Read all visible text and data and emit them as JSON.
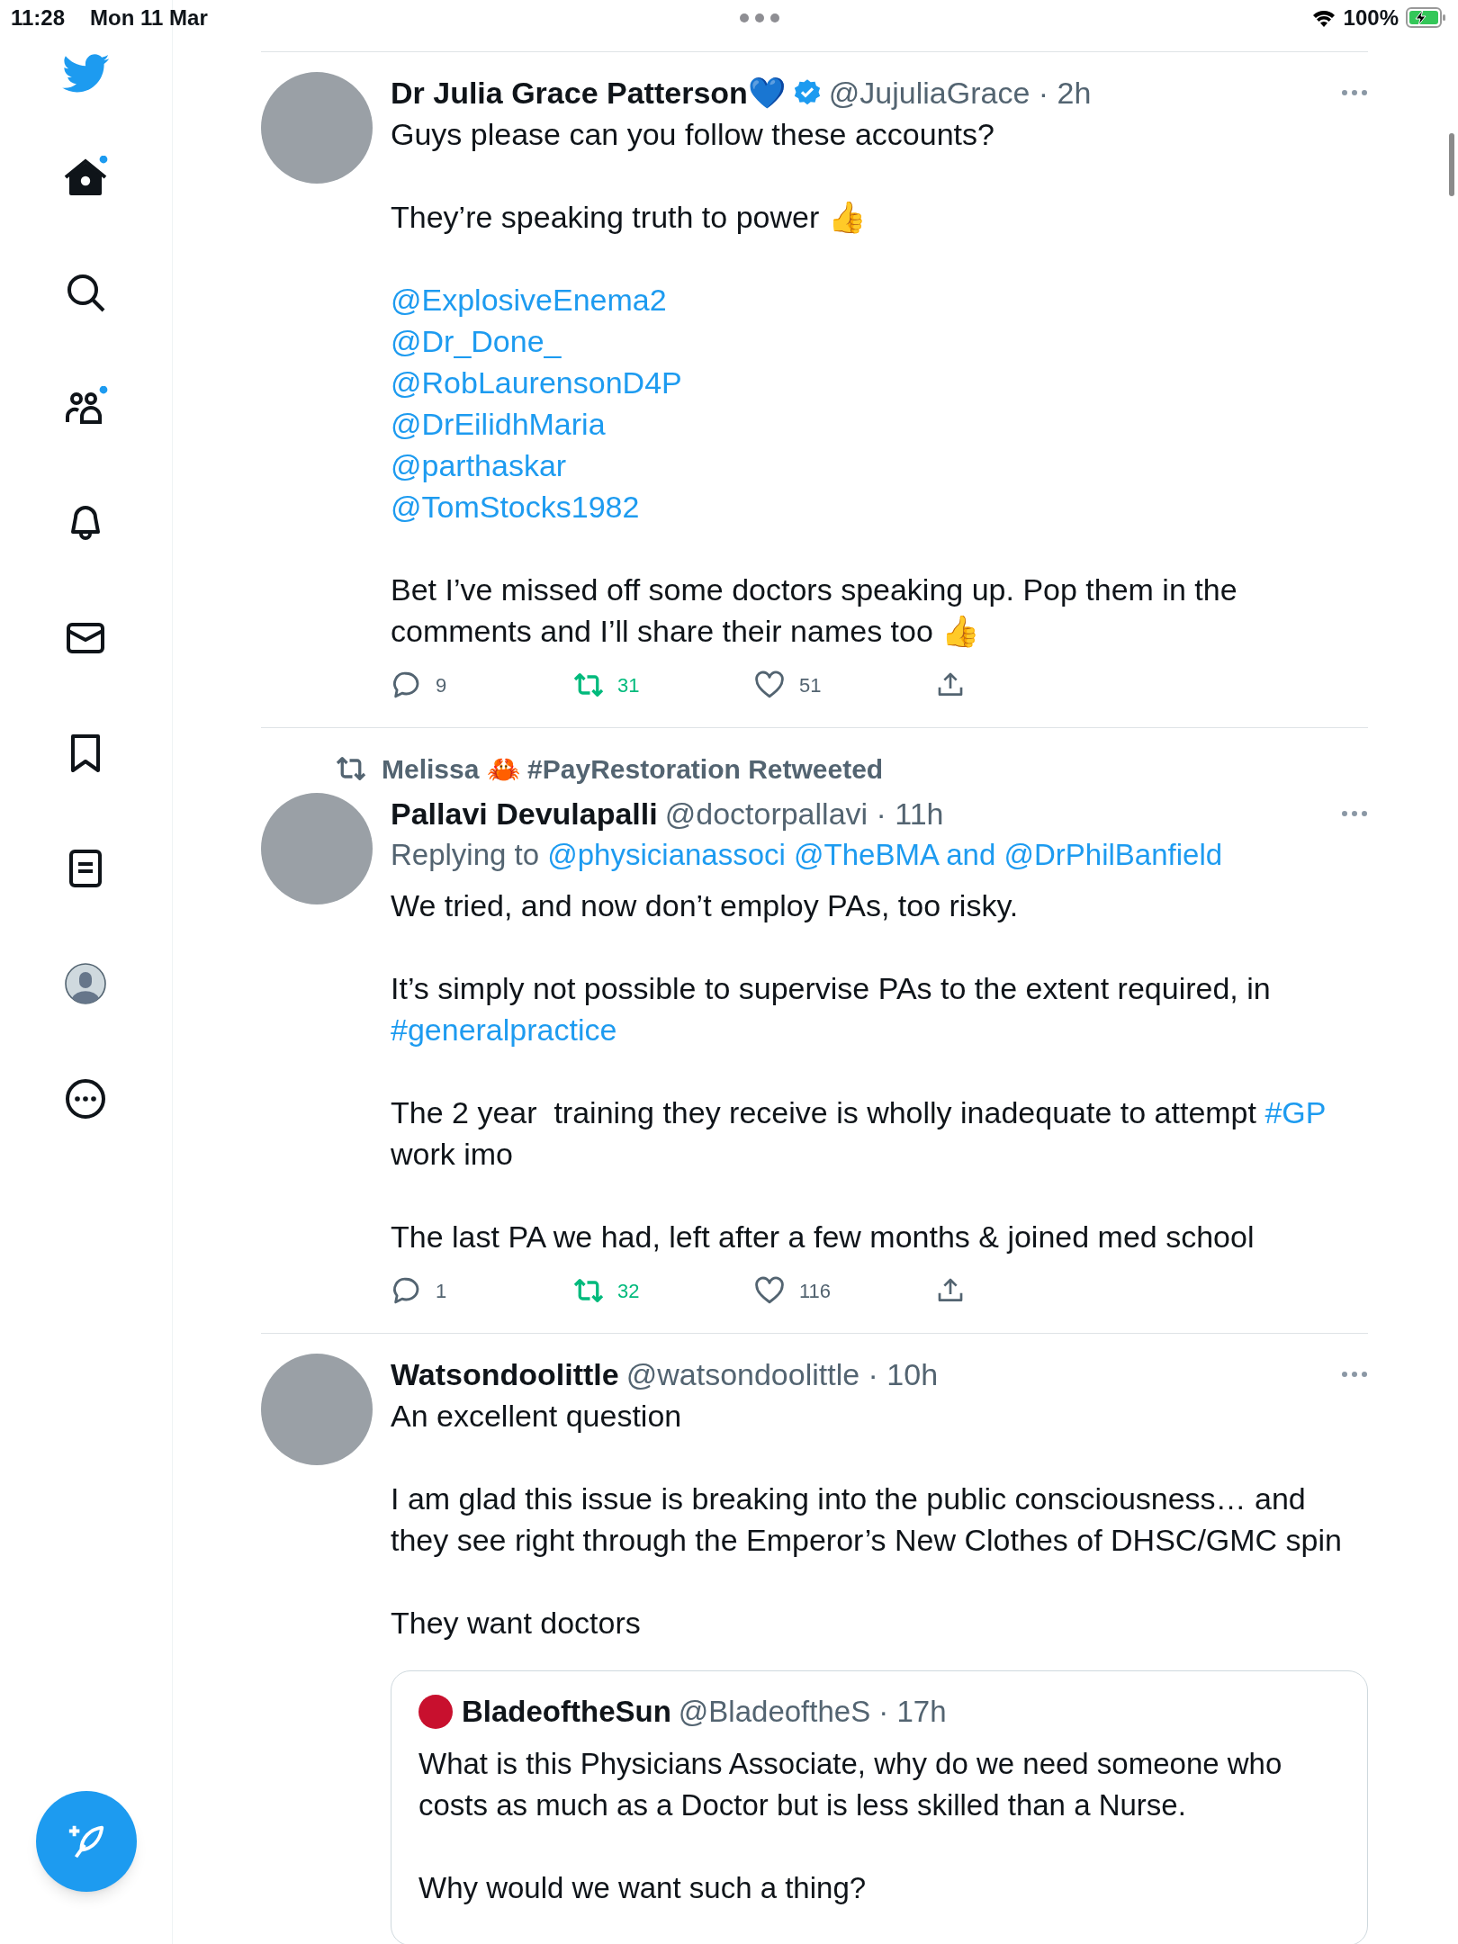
{
  "status_bar": {
    "time": "11:28",
    "date": "Mon 11 Mar",
    "battery": "100%",
    "charging": true
  },
  "sidebar": {
    "nav_items": [
      {
        "unread": true
      },
      {
        "unread": false
      },
      {
        "unread": true
      },
      {
        "unread": false
      },
      {
        "unread": false
      },
      {
        "unread": false
      },
      {
        "unread": false
      },
      {
        "unread": false
      },
      {
        "unread": false
      }
    ]
  },
  "tweets": [
    {
      "author": "Dr Julia Grace Patterson💙",
      "verified": true,
      "handle_time": "@JujuliaGrace · 2h",
      "body": [
        {
          "lines": [
            [
              {
                "text": "Guys please can you follow these accounts?",
                "link": false
              }
            ]
          ]
        },
        {
          "lines": [
            [
              {
                "text": "They’re speaking truth to power 👍",
                "link": false
              }
            ]
          ]
        },
        {
          "lines": [
            [
              {
                "text": "@ExplosiveEnema2",
                "link": true
              }
            ],
            [
              {
                "text": "@Dr_Done_",
                "link": true
              }
            ],
            [
              {
                "text": "@RobLaurensonD4P",
                "link": true
              }
            ],
            [
              {
                "text": "@DrEilidhMaria",
                "link": true
              }
            ],
            [
              {
                "text": "@parthaskar",
                "link": true
              }
            ],
            [
              {
                "text": "@TomStocks1982",
                "link": true
              }
            ]
          ]
        },
        {
          "lines": [
            [
              {
                "text": "Bet I’ve missed off some doctors speaking up. Pop them in the comments and I’ll share their names too 👍",
                "link": false
              }
            ]
          ]
        }
      ],
      "replies": "9",
      "retweets": "31",
      "retweeted": true,
      "likes": "51"
    },
    {
      "retweeted_by": "Melissa 🦀 #PayRestoration Retweeted",
      "author": "Pallavi Devulapalli",
      "verified": false,
      "handle_time": "@doctorpallavi · 11h",
      "replying_to": [
        {
          "text": "Replying to ",
          "link": false
        },
        {
          "text": "@physicianassoci @TheBMA and @DrPhilBanfield",
          "link": true
        }
      ],
      "body": [
        {
          "lines": [
            [
              {
                "text": "We tried, and now don’t employ PAs, too risky.",
                "link": false
              }
            ]
          ]
        },
        {
          "lines": [
            [
              {
                "text": "It’s simply not possible to supervise PAs to the extent required, in ",
                "link": false
              },
              {
                "text": "#generalpractice",
                "link": true
              }
            ]
          ]
        },
        {
          "lines": [
            [
              {
                "text": "The 2 year  training they receive is wholly inadequate to attempt ",
                "link": false
              },
              {
                "text": "#GP",
                "link": true
              },
              {
                "text": " work imo",
                "link": false
              }
            ]
          ]
        },
        {
          "lines": [
            [
              {
                "text": "The last PA we had, left after a few months & joined med school",
                "link": false
              }
            ]
          ]
        }
      ],
      "replies": "1",
      "retweets": "32",
      "retweeted": true,
      "likes": "116"
    },
    {
      "author": "Watsondoolittle",
      "verified": false,
      "handle_time": "@watsondoolittle · 10h",
      "body": [
        {
          "lines": [
            [
              {
                "text": "An excellent question",
                "link": false
              }
            ]
          ]
        },
        {
          "lines": [
            [
              {
                "text": "I am glad this issue is breaking into the public consciousness… and they see right through the Emperor’s New Clothes of DHSC/GMC spin",
                "link": false
              }
            ]
          ]
        },
        {
          "lines": [
            [
              {
                "text": "They want doctors",
                "link": false
              }
            ]
          ]
        }
      ],
      "quote": {
        "author": "BladeoftheSun",
        "handle_time": "@BladeoftheS · 17h",
        "body": [
          "What is this Physicians Associate, why do we need someone who costs as much as a Doctor but is less skilled than a Nurse.",
          "Why would we want such a thing?"
        ]
      }
    }
  ]
}
